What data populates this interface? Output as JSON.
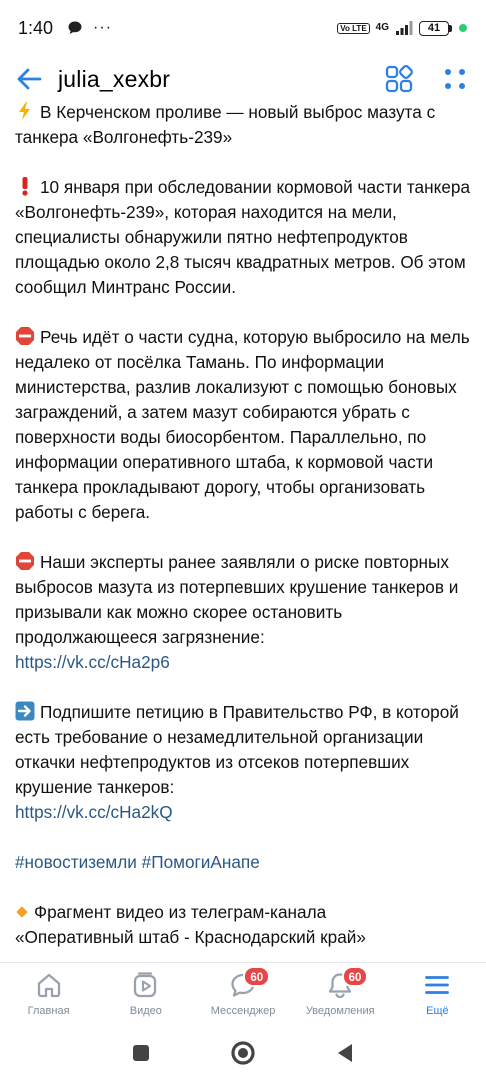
{
  "status_bar": {
    "time": "1:40",
    "more": "···",
    "volte": "Vo LTE",
    "network": "4G",
    "battery": "41"
  },
  "header": {
    "title": "julia_xexbr"
  },
  "post": {
    "intro_line1": "В Керченском проливе — новый выброс мазута с",
    "intro_line2": "танкера «Волгонефть-239»",
    "para1": "10 января при обследовании кормовой части танкера «Волгонефть-239», которая находится на мели, специалисты обнаружили пятно нефтепродуктов площадью около 2,8 тысяч квадратных метров. Об этом сообщил Минтранс России.",
    "para2": "Речь идёт о части судна, которую выбросило на мель недалеко от посёлка Тамань. По информации министерства, разлив локализуют с помощью боновых заграждений, а затем мазут собираются убрать с поверхности воды биосорбентом. Параллельно, по информации оперативного штаба, к кормовой части танкера прокладывают дорогу, чтобы организовать работы с берега.",
    "para3": "Наши эксперты ранее заявляли о риске повторных выбросов мазута из потерпевших крушение танкеров и призывали как можно скорее остановить продолжающееся загрязнение:",
    "link1": "https://vk.cc/cHa2p6",
    "para4": "Подпишите петицию в Правительство РФ, в которой есть требование о незамедлительной организации откачки нефтепродуктов из отсеков потерпевших крушение танкеров:",
    "link2": "https://vk.cc/cHa2kQ",
    "hashtag1": "#новостиземли",
    "hashtag2": "#ПомогиАнапе",
    "para5_line1": "Фрагмент видео из телеграм-канала",
    "para5_line2": "«Оперативный штаб - Краснодарский край»"
  },
  "bottom_nav": {
    "items": [
      {
        "label": "Главная"
      },
      {
        "label": "Видео"
      },
      {
        "label": "Мессенджер",
        "badge": "60"
      },
      {
        "label": "Уведомления",
        "badge": "60"
      },
      {
        "label": "Ещё"
      }
    ]
  },
  "colors": {
    "accent": "#2d81e0",
    "link": "#2a5885",
    "badge": "#e64646",
    "stop_sign": "#e0453a",
    "arrow_box": "#3b88c3"
  }
}
